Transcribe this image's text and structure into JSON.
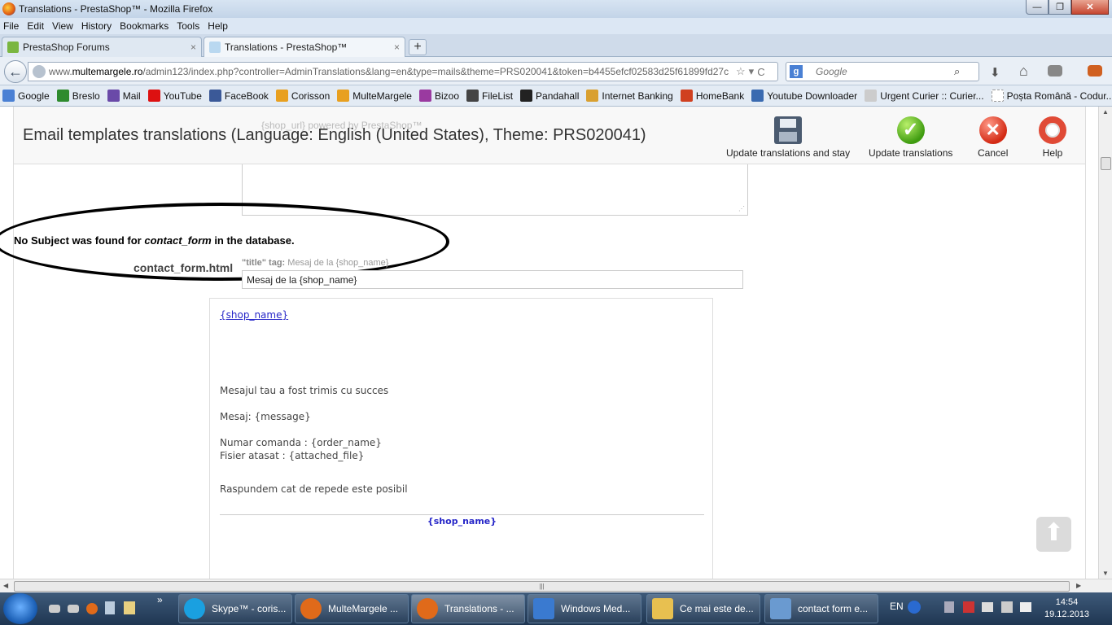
{
  "window": {
    "title": "Translations - PrestaShop™ - Mozilla Firefox",
    "minimize": "—",
    "maximize": "❐",
    "close": "✕"
  },
  "menu": [
    "File",
    "Edit",
    "View",
    "History",
    "Bookmarks",
    "Tools",
    "Help"
  ],
  "tabs": [
    {
      "label": "PrestaShop Forums",
      "close": "×"
    },
    {
      "label": "Translations - PrestaShop™",
      "close": "×"
    }
  ],
  "new_tab": "+",
  "nav": {
    "back": "←",
    "url_prefix": "www.",
    "url_domain": "multemargele.ro",
    "url_rest": "/admin123/index.php?controller=AdminTranslations&lang=en&type=mails&theme=PRS020041&token=b4455efcf02583d25f61899fd27c",
    "star": "☆",
    "dropdown": "▾",
    "reload": "C",
    "search_engine": "g",
    "search_placeholder": "Google",
    "search_icon": "⌕",
    "download": "⬇",
    "home": "⌂"
  },
  "bookmarks": [
    {
      "label": "Google",
      "color": "#4a80d4"
    },
    {
      "label": "Breslo",
      "color": "#2e8b2e"
    },
    {
      "label": "Mail",
      "color": "#6a4aa8"
    },
    {
      "label": "YouTube",
      "color": "#d11"
    },
    {
      "label": "FaceBook",
      "color": "#3b5998"
    },
    {
      "label": "Corisson",
      "color": "#e8a020"
    },
    {
      "label": "MulteMargele",
      "color": "#e8a020"
    },
    {
      "label": "Bizoo",
      "color": "#9a3aa0"
    },
    {
      "label": "FileList",
      "color": "#444"
    },
    {
      "label": "Pandahall",
      "color": "#222"
    },
    {
      "label": "Internet Banking",
      "color": "#d9a030"
    },
    {
      "label": "HomeBank",
      "color": "#d04020"
    },
    {
      "label": "Youtube Downloader",
      "color": "#3a6ab0"
    },
    {
      "label": "Urgent Curier :: Curier...",
      "color": "#ccc"
    },
    {
      "label": "Poșta Română - Codur...",
      "color": "#eee"
    }
  ],
  "bookmarks_more": "»",
  "page": {
    "faded_top_text": "{shop_url} powered by PrestaShop™",
    "title": "Email templates translations (Language: English (United States), Theme: PRS020041)",
    "buttons": {
      "update_stay": "Update translations and stay",
      "update": "Update translations",
      "cancel": "Cancel",
      "help": "Help"
    },
    "msg_prefix": "No Subject was found for ",
    "msg_em": "contact_form",
    "msg_suffix": " in the database.",
    "file_label": "contact_form.html",
    "title_tag_label": "\"title\" tag:",
    "title_tag_value": "Mesaj de la {shop_name}",
    "title_input_value": "Mesaj de la {shop_name}",
    "email": {
      "shop_link": "{shop_name}",
      "line1": "Mesajul tau a fost trimis cu succes",
      "line2": "Mesaj: {message}",
      "line3": "Numar comanda : {order_name}",
      "line4": "Fisier atasat : {attached_file}",
      "line5": "Raspundem cat de repede este posibil",
      "footer": "{shop_name}"
    },
    "scroll_top": "⬆"
  },
  "taskbar": {
    "items": [
      {
        "label": "Skype™ - coris...",
        "color": "#1aa0e0"
      },
      {
        "label": "MulteMargele ...",
        "color": "#e06a1a"
      },
      {
        "label": "Translations - ...",
        "color": "#e06a1a"
      },
      {
        "label": "Windows Med...",
        "color": "#3a7ad0"
      },
      {
        "label": "Ce mai este de...",
        "color": "#e8c050"
      },
      {
        "label": "contact form e...",
        "color": "#6a9ad0"
      }
    ],
    "lang": "EN",
    "time": "14:54",
    "date": "19.12.2013"
  }
}
